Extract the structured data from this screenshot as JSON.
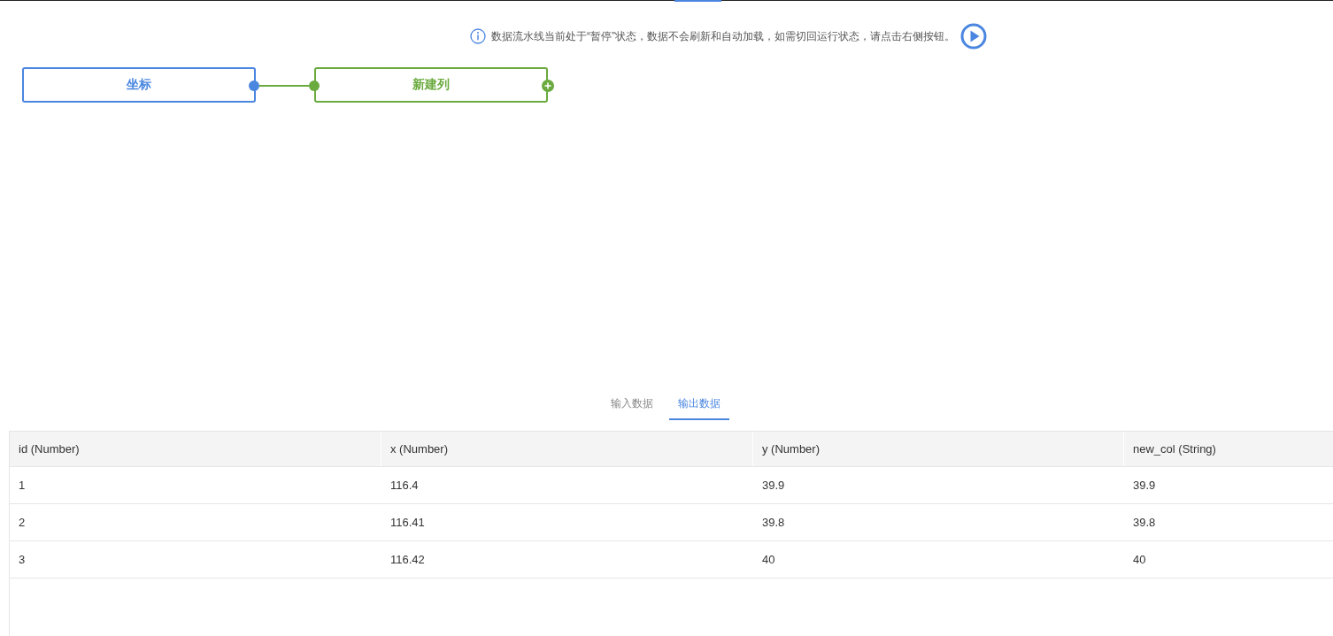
{
  "notice": {
    "text": "数据流水线当前处于“暂停”状态，数据不会刷新和自动加载，如需切回运行状态，请点击右侧按钮。",
    "paused": true
  },
  "nodes": [
    {
      "label": "坐标",
      "kind": "source",
      "color": "#4a86e0"
    },
    {
      "label": "新建列",
      "kind": "transform",
      "color": "#6aaa3e"
    }
  ],
  "tabs": [
    {
      "label": "输入数据",
      "selected": false
    },
    {
      "label": "输出数据",
      "selected": true
    }
  ],
  "table": {
    "columns": [
      "id (Number)",
      "x (Number)",
      "y (Number)",
      "new_col (String)"
    ],
    "rows": [
      [
        "1",
        "116.4",
        "39.9",
        "39.9"
      ],
      [
        "2",
        "116.41",
        "39.8",
        "39.8"
      ],
      [
        "3",
        "116.42",
        "40",
        "40"
      ]
    ]
  }
}
